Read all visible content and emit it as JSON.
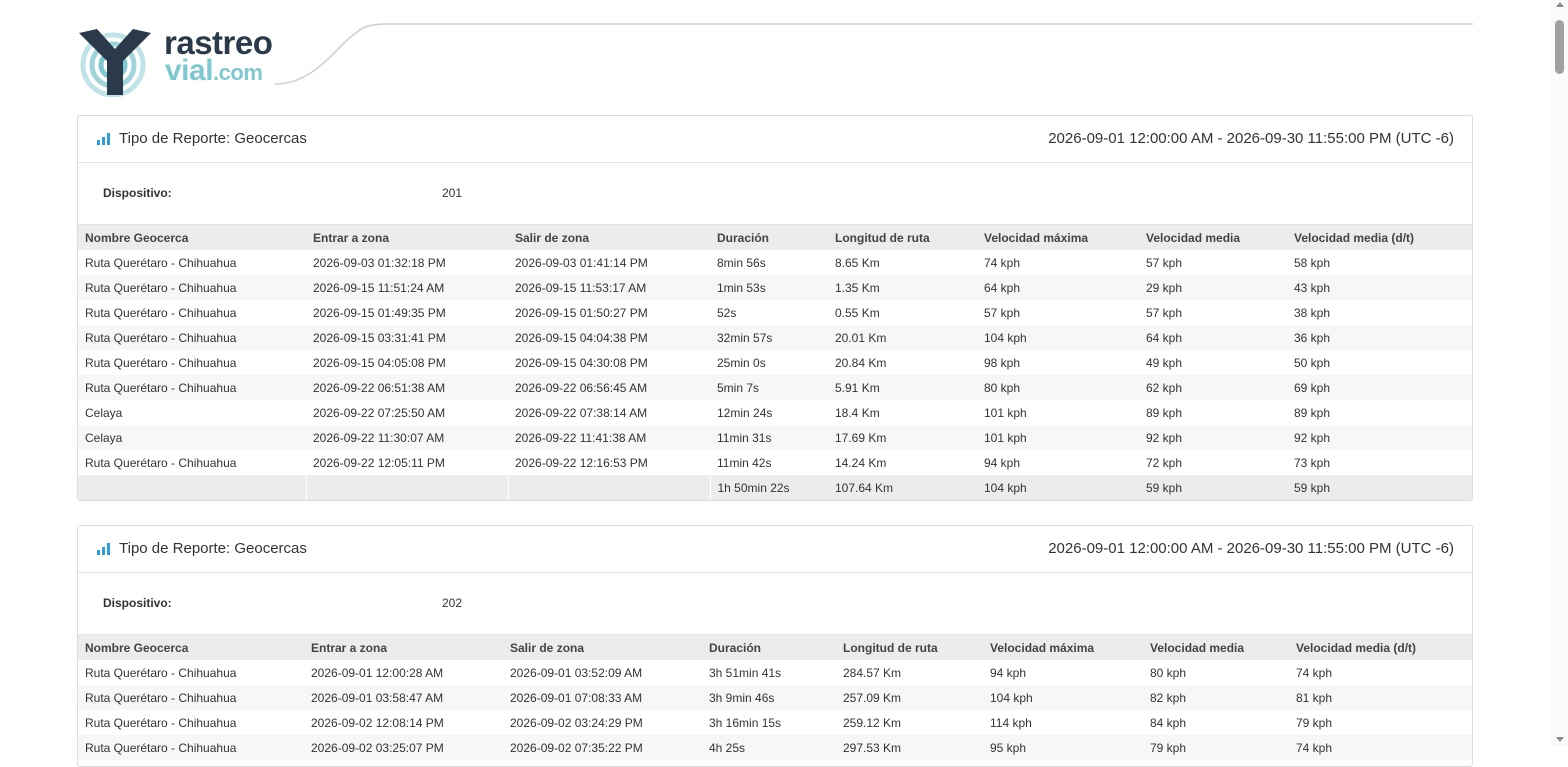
{
  "logo": {
    "line1": "rastreo",
    "line2": "vial",
    "line3": ".com",
    "primary_color": "#2b3a4a",
    "accent_color": "#7ec9d0"
  },
  "reports": [
    {
      "title": "Tipo de Reporte: Geocercas",
      "range": "2026-09-01 12:00:00 AM - 2026-09-30 11:55:00 PM (UTC -6)",
      "device_label": "Dispositivo:",
      "device_value": "201",
      "columns": [
        "Nombre Geocerca",
        "Entrar a zona",
        "Salir de zona",
        "Duración",
        "Longitud de ruta",
        "Velocidad máxima",
        "Velocidad media",
        "Velocidad media (d/t)"
      ],
      "rows": [
        [
          "Ruta Querétaro - Chihuahua",
          "2026-09-03 01:32:18 PM",
          "2026-09-03 01:41:14 PM",
          "8min 56s",
          "8.65 Km",
          "74 kph",
          "57 kph",
          "58 kph"
        ],
        [
          "Ruta Querétaro - Chihuahua",
          "2026-09-15 11:51:24 AM",
          "2026-09-15 11:53:17 AM",
          "1min 53s",
          "1.35 Km",
          "64 kph",
          "29 kph",
          "43 kph"
        ],
        [
          "Ruta Querétaro - Chihuahua",
          "2026-09-15 01:49:35 PM",
          "2026-09-15 01:50:27 PM",
          "52s",
          "0.55 Km",
          "57 kph",
          "57 kph",
          "38 kph"
        ],
        [
          "Ruta Querétaro - Chihuahua",
          "2026-09-15 03:31:41 PM",
          "2026-09-15 04:04:38 PM",
          "32min 57s",
          "20.01 Km",
          "104 kph",
          "64 kph",
          "36 kph"
        ],
        [
          "Ruta Querétaro - Chihuahua",
          "2026-09-15 04:05:08 PM",
          "2026-09-15 04:30:08 PM",
          "25min 0s",
          "20.84 Km",
          "98 kph",
          "49 kph",
          "50 kph"
        ],
        [
          "Ruta Querétaro - Chihuahua",
          "2026-09-22 06:51:38 AM",
          "2026-09-22 06:56:45 AM",
          "5min 7s",
          "5.91 Km",
          "80 kph",
          "62 kph",
          "69 kph"
        ],
        [
          "Celaya",
          "2026-09-22 07:25:50 AM",
          "2026-09-22 07:38:14 AM",
          "12min 24s",
          "18.4 Km",
          "101 kph",
          "89 kph",
          "89 kph"
        ],
        [
          "Celaya",
          "2026-09-22 11:30:07 AM",
          "2026-09-22 11:41:38 AM",
          "11min 31s",
          "17.69 Km",
          "101 kph",
          "92 kph",
          "92 kph"
        ],
        [
          "Ruta Querétaro - Chihuahua",
          "2026-09-22 12:05:11 PM",
          "2026-09-22 12:16:53 PM",
          "11min 42s",
          "14.24 Km",
          "94 kph",
          "72 kph",
          "73 kph"
        ]
      ],
      "total": [
        "",
        "",
        "",
        "1h 50min 22s",
        "107.64 Km",
        "104 kph",
        "59 kph",
        "59 kph"
      ]
    },
    {
      "title": "Tipo de Reporte: Geocercas",
      "range": "2026-09-01 12:00:00 AM - 2026-09-30 11:55:00 PM (UTC -6)",
      "device_label": "Dispositivo:",
      "device_value": "202",
      "columns": [
        "Nombre Geocerca",
        "Entrar a zona",
        "Salir de zona",
        "Duración",
        "Longitud de ruta",
        "Velocidad máxima",
        "Velocidad media",
        "Velocidad media (d/t)"
      ],
      "rows": [
        [
          "Ruta Querétaro - Chihuahua",
          "2026-09-01 12:00:28 AM",
          "2026-09-01 03:52:09 AM",
          "3h 51min 41s",
          "284.57 Km",
          "94 kph",
          "80 kph",
          "74 kph"
        ],
        [
          "Ruta Querétaro - Chihuahua",
          "2026-09-01 03:58:47 AM",
          "2026-09-01 07:08:33 AM",
          "3h 9min 46s",
          "257.09 Km",
          "104 kph",
          "82 kph",
          "81 kph"
        ],
        [
          "Ruta Querétaro - Chihuahua",
          "2026-09-02 12:08:14 PM",
          "2026-09-02 03:24:29 PM",
          "3h 16min 15s",
          "259.12 Km",
          "114 kph",
          "84 kph",
          "79 kph"
        ],
        [
          "Ruta Querétaro - Chihuahua",
          "2026-09-02 03:25:07 PM",
          "2026-09-02 07:35:22 PM",
          "4h 25s",
          "297.53 Km",
          "95 kph",
          "79 kph",
          "74 kph"
        ]
      ],
      "total": null
    }
  ]
}
